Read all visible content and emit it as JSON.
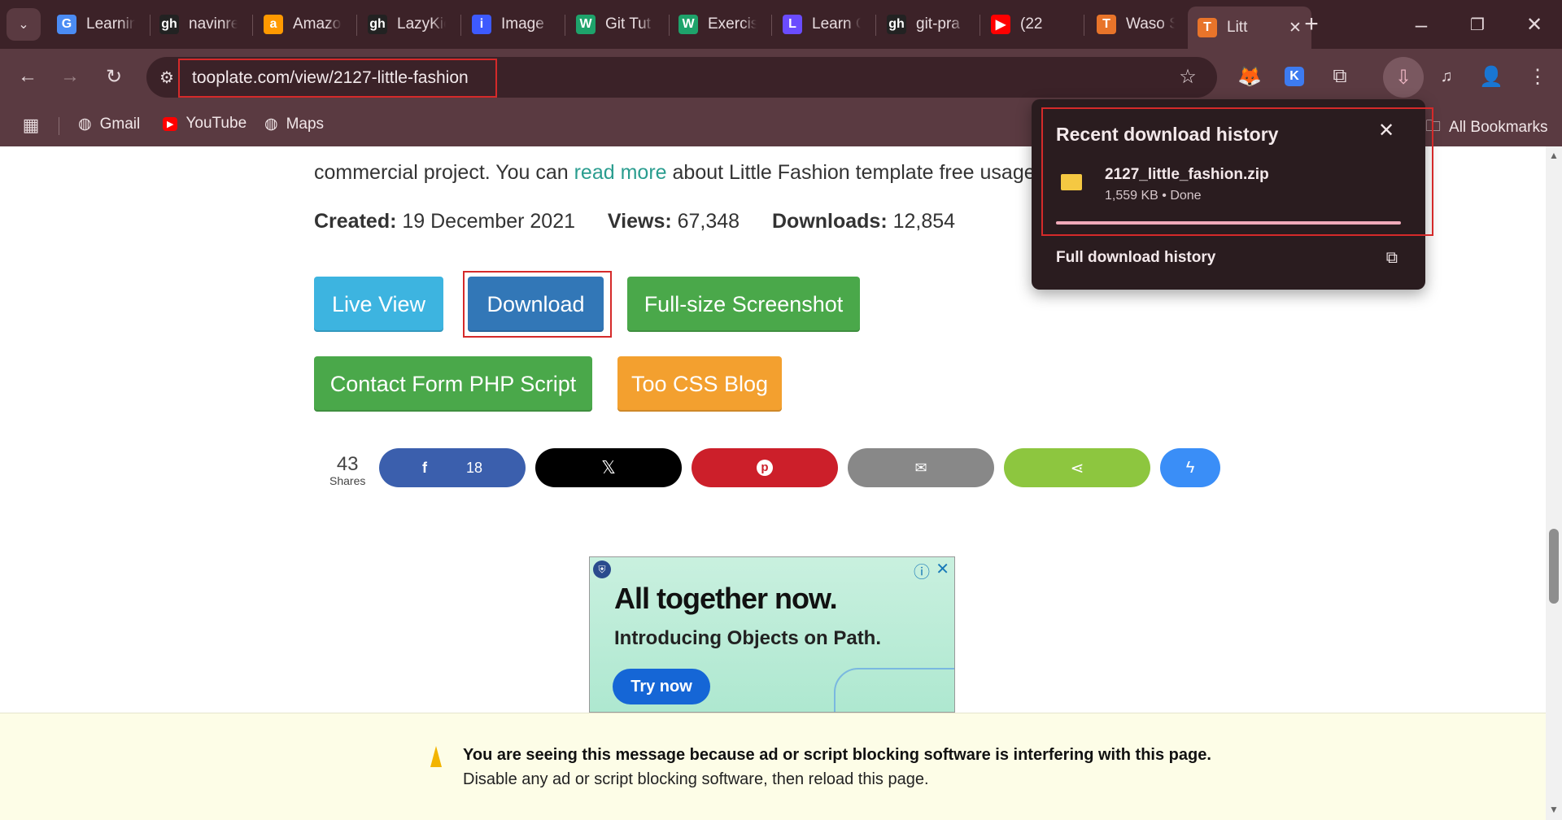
{
  "tabs": [
    {
      "label": "Learnin",
      "icon": "G",
      "color": "#4b8cf4"
    },
    {
      "label": "navinre",
      "icon": "gh",
      "color": "#222"
    },
    {
      "label": "Amazo",
      "icon": "a",
      "color": "#ff9900"
    },
    {
      "label": "LazyKic",
      "icon": "gh",
      "color": "#222"
    },
    {
      "label": "Image",
      "icon": "i",
      "color": "#3d5afe"
    },
    {
      "label": "Git Tut",
      "icon": "W",
      "color": "#1ea36b"
    },
    {
      "label": "Exercis",
      "icon": "W",
      "color": "#1ea36b"
    },
    {
      "label": "Learn C",
      "icon": "L",
      "color": "#6a4cff"
    },
    {
      "label": "git-pra",
      "icon": "gh",
      "color": "#222"
    },
    {
      "label": "(22",
      "icon": "▶",
      "color": "#ff0000"
    },
    {
      "label": "Waso S",
      "icon": "T",
      "color": "#e8742a"
    },
    {
      "label": "Litt",
      "icon": "T",
      "color": "#e8742a"
    }
  ],
  "url": "tooplate.com/view/2127-little-fashion",
  "bookmarks": {
    "gmail": "Gmail",
    "youtube": "YouTube",
    "maps": "Maps",
    "all": "All Bookmarks"
  },
  "page": {
    "intro_prefix": "commercial project. You can ",
    "intro_link": "read more",
    "intro_suffix": " about Little Fashion template free usage",
    "created_label": "Created:",
    "created_value": "19 December 2021",
    "views_label": "Views:",
    "views_value": "67,348",
    "downloads_label": "Downloads:",
    "downloads_value": "12,854",
    "buttons": {
      "live": "Live View",
      "download": "Download",
      "screenshot": "Full-size Screenshot",
      "contact": "Contact Form PHP Script",
      "blog": "Too CSS Blog"
    },
    "shares_count": "43",
    "shares_label": "Shares",
    "fb_count": "18"
  },
  "ad": {
    "headline": "All together now.",
    "sub": "Introducing Objects on Path.",
    "cta": "Try now"
  },
  "popup": {
    "title": "Recent download history",
    "file": "2127_little_fashion.zip",
    "meta": "1,559 KB • Done",
    "full": "Full download history",
    "progress": 1.0
  },
  "banner": {
    "line1": "You are seeing this message because ad or script blocking software is interfering with this page.",
    "line2": "Disable any ad or script blocking software, then reload this page."
  },
  "colors": {
    "live": "#3db4e0",
    "download": "#3277b7",
    "green": "#4aa84a",
    "blog": "#f3a02f",
    "fb": "#3b5fad",
    "x": "#000000",
    "pin": "#cc1f2a",
    "mail": "#888888",
    "share": "#8dc63f",
    "msg": "#3a8ef7"
  }
}
